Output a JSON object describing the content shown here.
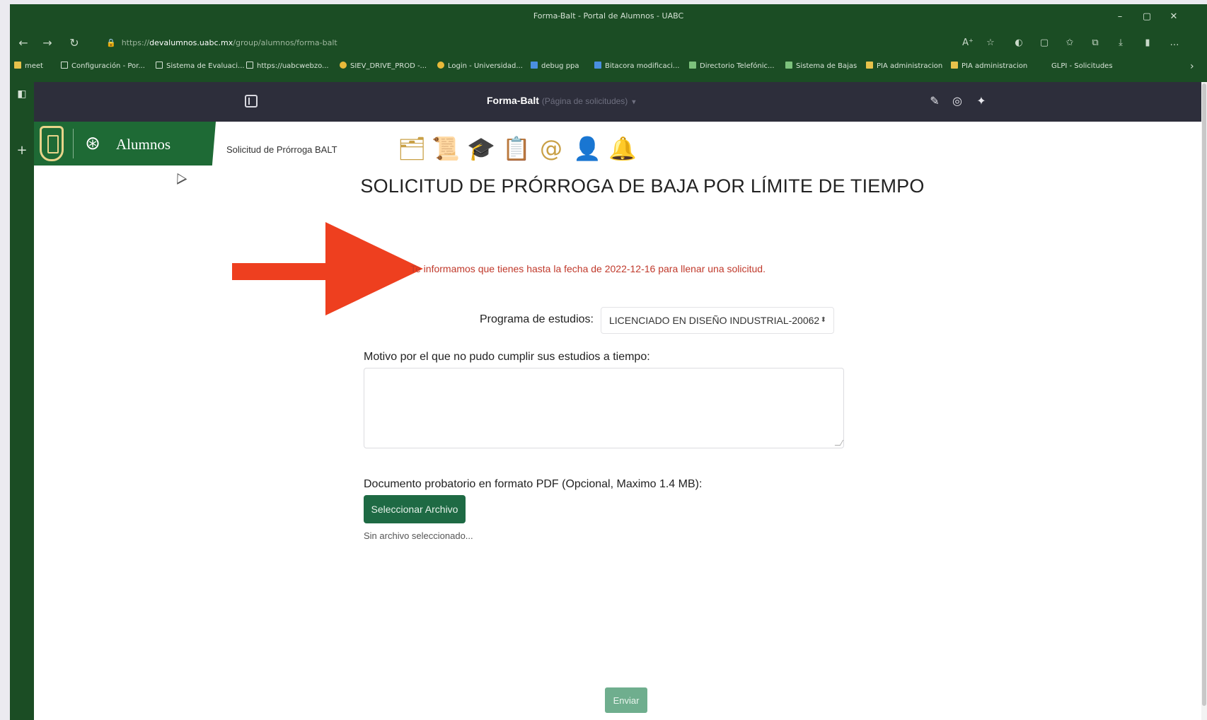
{
  "window": {
    "title": "Forma-Balt - Portal de Alumnos - UABC",
    "controls": {
      "minimize": "–",
      "maximize": "▢",
      "close": "✕"
    }
  },
  "browser": {
    "back": "←",
    "forward": "→",
    "reload": "↻",
    "url_lock": "🔒",
    "url_scheme": "https://",
    "url_host": "devalumnos.uabc.mx",
    "url_path": "/group/alumnos/forma-balt",
    "toolbar_icons": [
      "A⁺",
      "☆",
      "◐",
      "▢",
      "✩",
      "⧉",
      "⤓",
      "▮",
      "…"
    ]
  },
  "bookmarks": [
    {
      "label": "meet",
      "icon": "folder"
    },
    {
      "label": "Configuración - Por...",
      "icon": "page"
    },
    {
      "label": "Sistema de Evaluaci...",
      "icon": "page"
    },
    {
      "label": "https://uabcwebzo...",
      "icon": "page"
    },
    {
      "label": "SIEV_DRIVE_PROD -...",
      "icon": "yellow"
    },
    {
      "label": "Login - Universidad...",
      "icon": "yellow"
    },
    {
      "label": "debug ppa",
      "icon": "blue"
    },
    {
      "label": "Bitacora modificaci...",
      "icon": "blue"
    },
    {
      "label": "Directorio Telefónic...",
      "icon": "green"
    },
    {
      "label": "Sistema de Bajas",
      "icon": "green"
    },
    {
      "label": "PIA administracion",
      "icon": "folder"
    },
    {
      "label": "PIA administracion",
      "icon": "folder"
    },
    {
      "label": "GLPI - Solicitudes",
      "icon": "page"
    }
  ],
  "bookmarks_more": "›",
  "tabstrip": {
    "tab_icon": "◧",
    "add": "+"
  },
  "app": {
    "title": "Forma-Balt",
    "subtitle": "(Página de solicitudes)",
    "caret": "▾",
    "header_icons": {
      "edit": "✎",
      "settings": "◎",
      "globe": "✦"
    },
    "badge_label": "Alumnos",
    "badge_icon": "⊛",
    "breadcrumb": "Solicitud de Prórroga BALT",
    "nav_icons": [
      "🗂",
      "📜",
      "🎓",
      "📋",
      "@",
      "👤",
      "🔔"
    ]
  },
  "form": {
    "title": "SOLICITUD DE PRÓRROGA DE BAJA POR LÍMITE DE TIEMPO",
    "deadline_notice": "Te informamos que tienes hasta la fecha de 2022-12-16 para llenar una solicitud.",
    "program_label": "Programa de estudios:",
    "program_selected": "LICENCIADO EN DISEÑO INDUSTRIAL-20062",
    "program_arrows": "⬍",
    "motivo_label": "Motivo por el que no pudo cumplir sus estudios a tiempo:",
    "motivo_value": "",
    "document_label": "Documento probatorio en formato PDF (Opcional, Maximo 1.4 MB):",
    "file_button": "Seleccionar Archivo",
    "file_status": "Sin archivo seleccionado...",
    "submit": "Enviar"
  },
  "colors": {
    "browser_chrome": "#1b4d24",
    "app_header": "#2d2e3b",
    "brand_green": "#1e6a35",
    "gold": "#c9a046",
    "notice_red": "#c0392b",
    "arrow": "#ee3f1f"
  }
}
